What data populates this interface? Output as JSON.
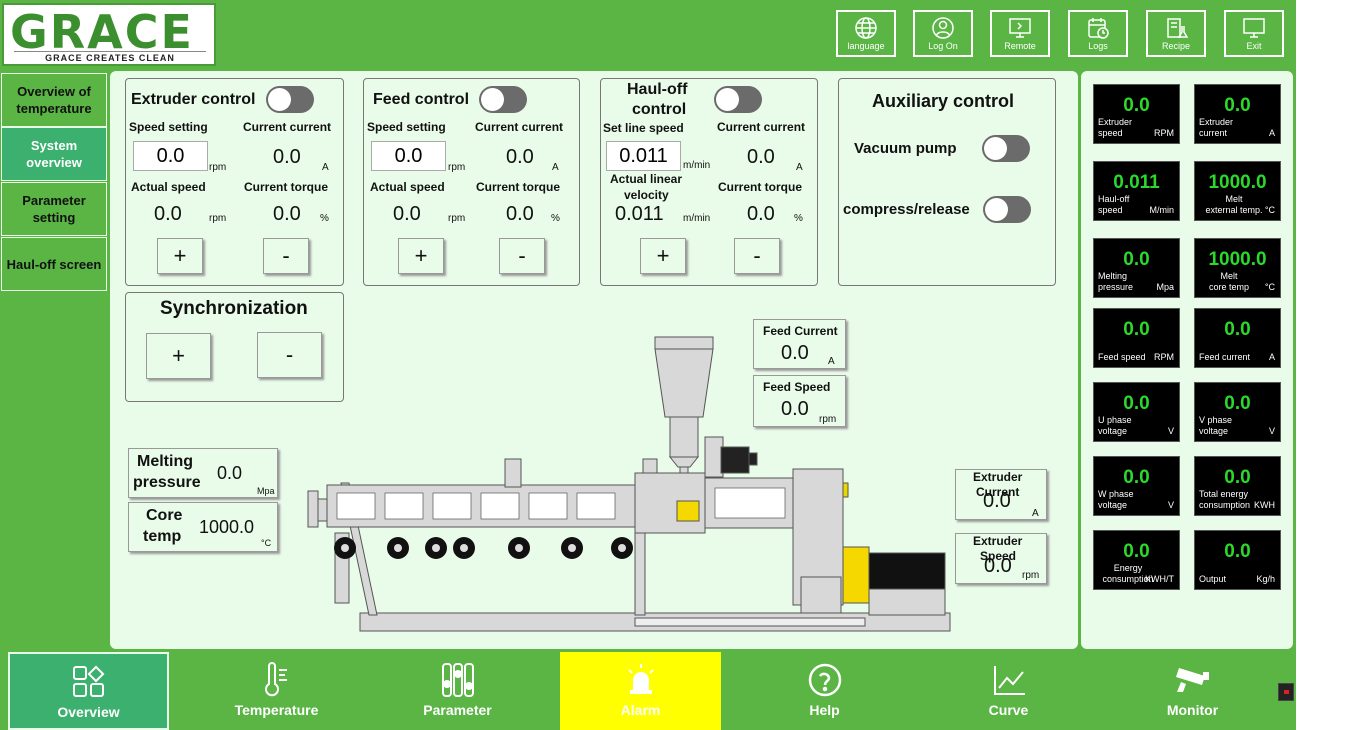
{
  "brand": {
    "logo": "GRACE",
    "slogan": "GRACE CREATES CLEAN"
  },
  "topbar": [
    {
      "label": "language",
      "icon": "globe-icon"
    },
    {
      "label": "Log On",
      "icon": "user-icon"
    },
    {
      "label": "Remote",
      "icon": "remote-icon"
    },
    {
      "label": "Logs",
      "icon": "calendar-icon"
    },
    {
      "label": "Recipe",
      "icon": "recipe-icon"
    },
    {
      "label": "Exit",
      "icon": "exit-icon"
    }
  ],
  "sidebar": [
    {
      "label": "Overview of temperature"
    },
    {
      "label": "System overview"
    },
    {
      "label": "Parameter setting"
    },
    {
      "label": "Haul-off screen"
    }
  ],
  "extruder": {
    "title": "Extruder control",
    "speed_setting": "Speed setting",
    "speed_value": "0.0",
    "speed_unit": "rpm",
    "current_label": "Current current",
    "current_value": "0.0",
    "current_unit": "A",
    "actual_label": "Actual speed",
    "actual_value": "0.0",
    "actual_unit": "rpm",
    "torque_label": "Current torque",
    "torque_value": "0.0",
    "torque_unit": "%",
    "plus": "+",
    "minus": "-"
  },
  "feed": {
    "title": "Feed control",
    "speed_setting": "Speed setting",
    "speed_value": "0.0",
    "speed_unit": "rpm",
    "current_label": "Current current",
    "current_value": "0.0",
    "current_unit": "A",
    "actual_label": "Actual speed",
    "actual_value": "0.0",
    "actual_unit": "rpm",
    "torque_label": "Current torque",
    "torque_value": "0.0",
    "torque_unit": "%",
    "plus": "+",
    "minus": "-"
  },
  "hauloff": {
    "title1": "Haul-off",
    "title2": "control",
    "speed_setting": "Set line speed",
    "speed_value": "0.011",
    "speed_unit": "m/min",
    "current_label": "Current current",
    "current_value": "0.0",
    "current_unit": "A",
    "actual_label1": "Actual linear",
    "actual_label2": "velocity",
    "actual_value": "0.011",
    "actual_unit": "m/min",
    "torque_label": "Current torque",
    "torque_value": "0.0",
    "torque_unit": "%",
    "plus": "+",
    "minus": "-"
  },
  "auxiliary": {
    "title": "Auxiliary control",
    "vacuum": "Vacuum pump",
    "compress": "compress/release"
  },
  "sync": {
    "title": "Synchronization",
    "plus": "+",
    "minus": "-"
  },
  "feed_current": {
    "label": "Feed Current",
    "value": "0.0",
    "unit": "A"
  },
  "feed_speed": {
    "label": "Feed Speed",
    "value": "0.0",
    "unit": "rpm"
  },
  "melting": {
    "label1": "Melting",
    "label2": "pressure",
    "value": "0.0",
    "unit": "Mpa"
  },
  "core": {
    "label1": "Core",
    "label2": "temp",
    "value": "1000.0",
    "unit": "°C"
  },
  "ext_current": {
    "label1": "Extruder",
    "label2": "Current",
    "value": "0.0",
    "unit": "A"
  },
  "ext_speed": {
    "label1": "Extruder",
    "label2": "Speed",
    "value": "0.0",
    "unit": "rpm"
  },
  "monitors": [
    {
      "value": "0.0",
      "label": "Extruder\nspeed",
      "unit": "RPM"
    },
    {
      "value": "0.0",
      "label": "Extruder\ncurrent",
      "unit": "A"
    },
    {
      "value": "0.011",
      "label": "Haul-off\nspeed",
      "unit": "M/min"
    },
    {
      "value": "1000.0",
      "label": "Melt\nexternal temp.",
      "unit": "°C"
    },
    {
      "value": "0.0",
      "label": "Melting\npressure",
      "unit": "Mpa"
    },
    {
      "value": "1000.0",
      "label": "Melt\ncore temp",
      "unit": "°C"
    },
    {
      "value": "0.0",
      "label": "Feed speed",
      "unit": "RPM"
    },
    {
      "value": "0.0",
      "label": "Feed current",
      "unit": "A"
    },
    {
      "value": "0.0",
      "label": "U phase\nvoltage",
      "unit": "V"
    },
    {
      "value": "0.0",
      "label": "V phase\nvoltage",
      "unit": "V"
    },
    {
      "value": "0.0",
      "label": "W phase\nvoltage",
      "unit": "V"
    },
    {
      "value": "0.0",
      "label": "Total energy\nconsumption",
      "unit": "KWH"
    },
    {
      "value": "0.0",
      "label": "Energy\nconsumption",
      "unit": "KWH/T"
    },
    {
      "value": "0.0",
      "label": "Output",
      "unit": "Kg/h"
    }
  ],
  "bottomnav": [
    {
      "label": "Overview",
      "icon": "grid-icon"
    },
    {
      "label": "Temperature",
      "icon": "thermometer-icon"
    },
    {
      "label": "Parameter",
      "icon": "sliders-icon"
    },
    {
      "label": "Alarm",
      "icon": "alarm-icon"
    },
    {
      "label": "Help",
      "icon": "help-icon"
    },
    {
      "label": "Curve",
      "icon": "chart-icon"
    },
    {
      "label": "Monitor",
      "icon": "camera-icon"
    }
  ],
  "colors": {
    "green": "#5ab545",
    "panel": "#e9fbe9",
    "active": "#3cb06e",
    "alarm": "#ffff00",
    "lcd": "#2bd92b"
  }
}
